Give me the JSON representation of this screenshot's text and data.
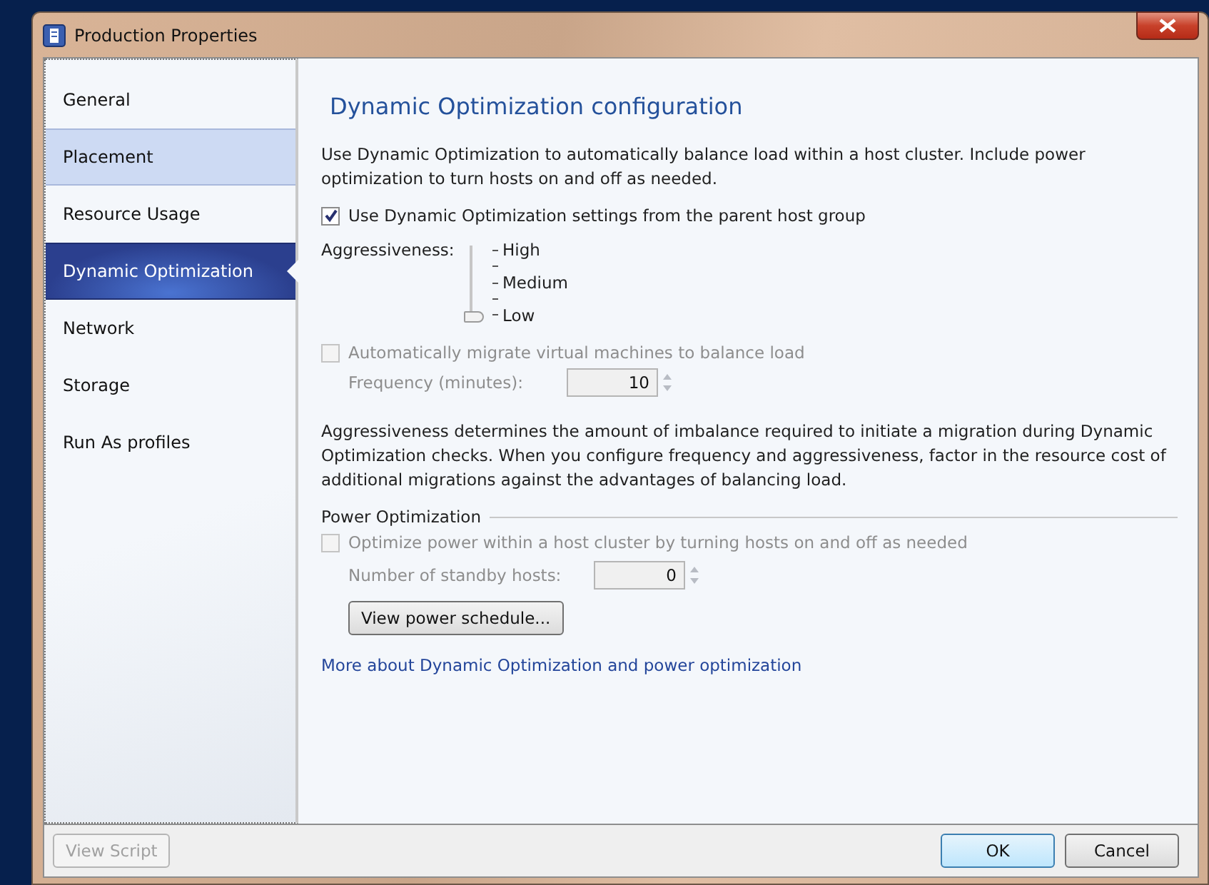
{
  "window": {
    "title": "Production Properties"
  },
  "sidebar": {
    "items": [
      {
        "label": "General",
        "selected": false,
        "highlighted": false
      },
      {
        "label": "Placement",
        "selected": false,
        "highlighted": true
      },
      {
        "label": "Resource Usage",
        "selected": false,
        "highlighted": false
      },
      {
        "label": "Dynamic Optimization",
        "selected": true,
        "highlighted": false
      },
      {
        "label": "Network",
        "selected": false,
        "highlighted": false
      },
      {
        "label": "Storage",
        "selected": false,
        "highlighted": false
      },
      {
        "label": "Run As profiles",
        "selected": false,
        "highlighted": false
      }
    ]
  },
  "page": {
    "heading": "Dynamic Optimization configuration",
    "intro": "Use Dynamic Optimization to automatically balance load within a host cluster. Include power optimization to turn hosts on and off as needed.",
    "inherit_checkbox": {
      "label": "Use Dynamic Optimization settings from the parent host group",
      "checked": true,
      "disabled": false
    },
    "aggressiveness": {
      "label": "Aggressiveness:",
      "ticks": [
        "High",
        "Medium",
        "Low"
      ],
      "level": 0
    },
    "migrate_checkbox": {
      "label": "Automatically migrate virtual machines to balance load",
      "checked": false,
      "disabled": true
    },
    "frequency": {
      "label": "Frequency (minutes):",
      "value": "10",
      "disabled": true
    },
    "explanation": "Aggressiveness determines the amount of imbalance required to initiate a migration during Dynamic Optimization checks.  When you configure frequency and aggressiveness, factor in the resource cost of additional migrations against the advantages of balancing load.",
    "power_section": {
      "title": "Power Optimization"
    },
    "power_checkbox": {
      "label": "Optimize power within a host cluster by turning hosts on and off as needed",
      "checked": false,
      "disabled": true
    },
    "standby": {
      "label": "Number of standby hosts:",
      "value": "0",
      "disabled": true
    },
    "schedule_button": {
      "label": "View power schedule...",
      "disabled": false
    },
    "link": "More about Dynamic Optimization and power optimization"
  },
  "footer": {
    "buttons": [
      {
        "label": "View Script",
        "disabled": true,
        "default": false
      },
      {
        "label": "OK",
        "disabled": false,
        "default": true
      },
      {
        "label": "Cancel",
        "disabled": false,
        "default": false
      }
    ]
  }
}
